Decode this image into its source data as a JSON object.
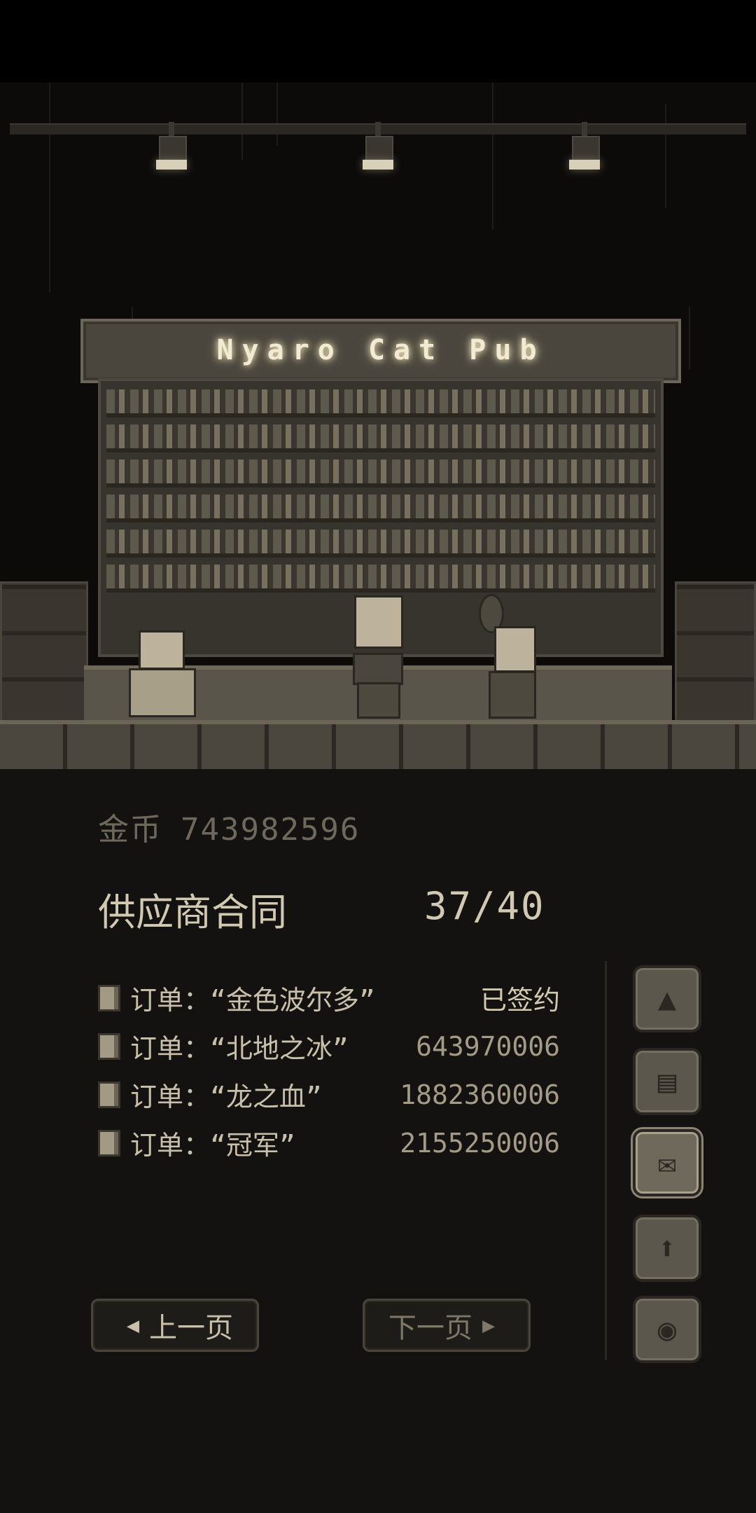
{
  "scene": {
    "sign_text": "Nyaro Cat Pub"
  },
  "gold": {
    "label": "金币",
    "value": "743982596"
  },
  "contract": {
    "title": "供应商合同",
    "progress": "37/40"
  },
  "orders": [
    {
      "label": "订单：“金色波尔多”",
      "value": "已签约"
    },
    {
      "label": "订单：“北地之冰”",
      "value": "643970006"
    },
    {
      "label": "订单：“龙之血”",
      "value": "1882360006"
    },
    {
      "label": "订单：“冠军”",
      "value": "2155250006"
    }
  ],
  "side_buttons": [
    {
      "icon": "tent-icon"
    },
    {
      "icon": "document-icon"
    },
    {
      "icon": "scroll-icon",
      "active": true
    },
    {
      "icon": "arrow-up-icon"
    },
    {
      "icon": "record-disc-icon"
    }
  ],
  "pagination": {
    "prev_label": "上一页",
    "next_label": "下一页"
  }
}
